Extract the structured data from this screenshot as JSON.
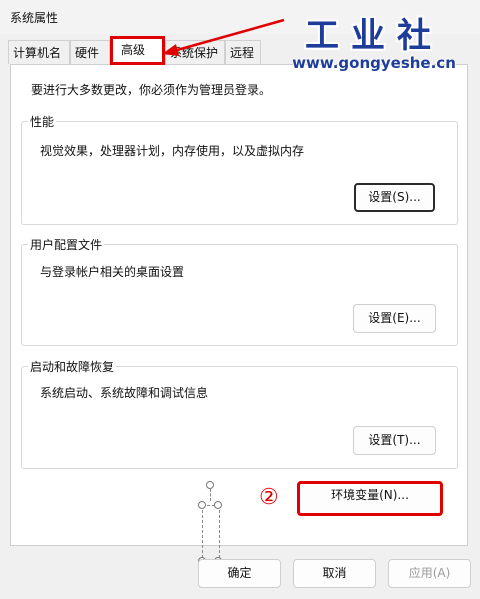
{
  "window": {
    "title": "系统属性"
  },
  "tabs": [
    {
      "label": "计算机名"
    },
    {
      "label": "硬件"
    },
    {
      "label": "高级"
    },
    {
      "label": "系统保护"
    },
    {
      "label": "远程"
    }
  ],
  "panel": {
    "note": "要进行大多数更改，你必须作为管理员登录。",
    "performance": {
      "legend": "性能",
      "desc": "视觉效果，处理器计划，内存使用，以及虚拟内存",
      "button": "设置(S)..."
    },
    "profiles": {
      "legend": "用户配置文件",
      "desc": "与登录帐户相关的桌面设置",
      "button": "设置(E)..."
    },
    "startup": {
      "legend": "启动和故障恢复",
      "desc": "系统启动、系统故障和调试信息",
      "button": "设置(T)..."
    },
    "env_button": "环境变量(N)...",
    "step_marker": "②"
  },
  "footer": {
    "ok": "确定",
    "cancel": "取消",
    "apply": "应用(A)"
  },
  "watermark": {
    "title": "工业社",
    "url": "www.gongyeshe.cn"
  },
  "colors": {
    "highlight": "#e00000",
    "brand": "#1e3d9b"
  }
}
